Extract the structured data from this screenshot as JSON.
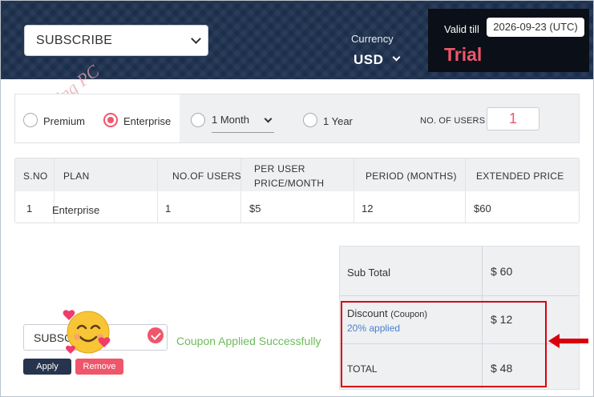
{
  "header": {
    "plan_select": "SUBSCRIBE",
    "currency_label": "Currency",
    "currency_value": "USD",
    "valid_label": "Valid till",
    "valid_date": "2026-09-23 (UTC)",
    "trial_label": "Trial"
  },
  "watermark": "Winning PC",
  "options": {
    "edition_options": [
      "Premium",
      "Enterprise"
    ],
    "selected_edition": "Enterprise",
    "period_dropdown": "1 Month",
    "year_option": "1 Year",
    "users_label": "NO. OF USERS",
    "users_value": "1"
  },
  "plan_table": {
    "headers": [
      "S.NO",
      "PLAN",
      "NO.OF USERS",
      "PER USER",
      "PRICE/MONTH",
      "PERIOD (MONTHS)",
      "EXTENDED PRICE"
    ],
    "rows": [
      [
        "1",
        "Enterprise",
        "1",
        "$5",
        "12",
        "$60"
      ]
    ]
  },
  "summary": {
    "subtotal_label": "Sub Total",
    "subtotal_value": "$ 60",
    "discount_label": "Discount",
    "discount_note": "(Coupon)",
    "discount_applied": "20% applied",
    "discount_value": "$ 12",
    "total_label": "TOTAL",
    "total_value": "$ 48"
  },
  "coupon": {
    "value": "SUBSC",
    "success_message": "Coupon Applied Successfully",
    "apply_label": "Apply",
    "remove_label": "Remove"
  },
  "colors": {
    "header_bg": "#1b2e4b",
    "accent": "#f0566b",
    "success": "#6dbb5a",
    "highlight": "#d9000d",
    "apply_bg": "#26344e"
  }
}
